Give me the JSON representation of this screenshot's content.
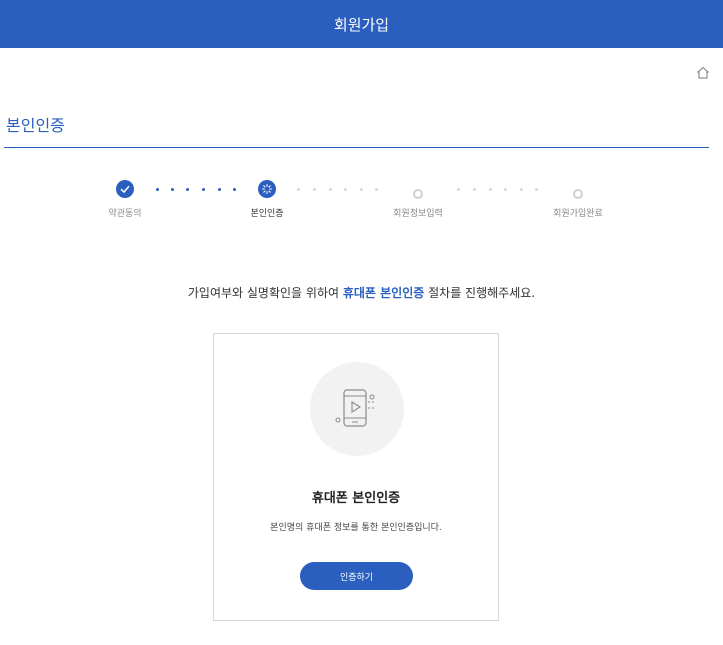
{
  "header": {
    "title": "회원가입"
  },
  "home": {
    "icon": "home-icon"
  },
  "section": {
    "title": "본인인증"
  },
  "stepper": {
    "steps": [
      {
        "label": "약관동의",
        "status": "completed",
        "icon": "check-icon"
      },
      {
        "label": "본인인증",
        "status": "current",
        "icon": "loading-spinner-icon"
      },
      {
        "label": "회원정보입력",
        "status": "pending",
        "icon": "pending-step-icon"
      },
      {
        "label": "회원가입완료",
        "status": "pending",
        "icon": "pending-step-icon"
      }
    ]
  },
  "intro": {
    "before": "가입여부와 실명확인을 위하여 ",
    "highlight": "휴대폰 본인인증",
    "after": " 절차를 진행해주세요."
  },
  "card": {
    "icon": "mobile-phone-icon",
    "title": "휴대폰 본인인증",
    "description": "본인명의 휴대폰 정보를 통한 본인인증입니다.",
    "button_label": "인증하기"
  },
  "colors": {
    "accent": "#2a5fbf",
    "dot_inactive": "#d8d8d8",
    "border": "#d6d6d6"
  }
}
